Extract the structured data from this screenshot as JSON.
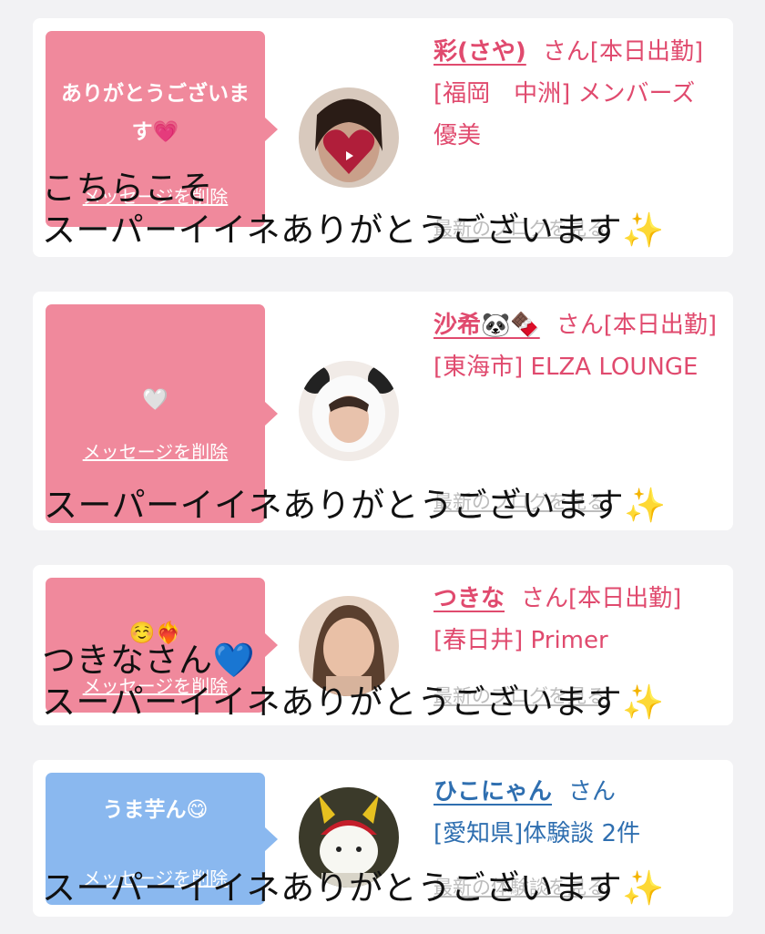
{
  "notifications": [
    {
      "bubble_text": "ありがとうございます💗",
      "delete_label": "メッセージを削除",
      "name": "彩(さや)",
      "san": "さん",
      "details": "[本日出勤]",
      "location": "[福岡　中洲] メンバーズ 優美",
      "blog_link": "最新のブログを見る",
      "overlay_lines": [
        "こちらこそ",
        "スーパーイイネありがとうございます✨"
      ]
    },
    {
      "bubble_text": "🤍",
      "delete_label": "メッセージを削除",
      "name": "沙希🐼🍫",
      "san": "さん",
      "details": "[本日出勤]",
      "location": "[東海市] ELZA LOUNGE",
      "blog_link": "最新のブログを見る",
      "overlay_lines": [
        "スーパーイイネありがとうございます✨"
      ]
    },
    {
      "bubble_text": "☺️❤️‍🔥",
      "delete_label": "メッセージを削除",
      "name": "つきな",
      "san": "さん",
      "details": "[本日出勤]",
      "location": "[春日井] Primer",
      "blog_link": "最新のブログを見る",
      "overlay_lines": [
        "つきなさん💙",
        "スーパーイイネありがとうございます✨"
      ]
    },
    {
      "bubble_text": "うま芋ん😋",
      "delete_label": "メッセージを削除",
      "name": "ひこにゃん",
      "san": "さん",
      "details": "",
      "location": "[愛知県]体験談 2件",
      "blog_link": "最新の体験談を見る",
      "overlay_lines": [
        "スーパーイイネありがとうございます✨"
      ]
    }
  ],
  "colors": {
    "pink_bubble": "#f0899c",
    "blue_bubble": "#8ab8ef",
    "pink_text": "#e04a6e",
    "blue_text": "#2f6fb0"
  }
}
